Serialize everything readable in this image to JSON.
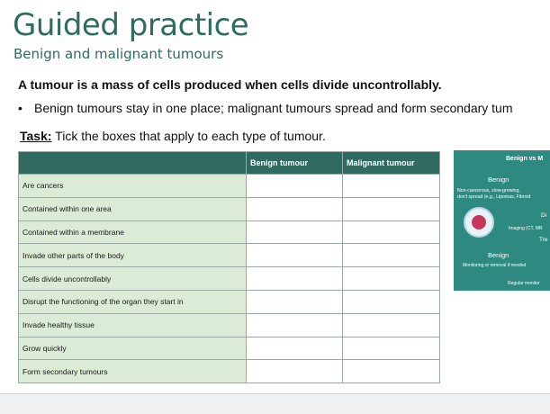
{
  "header": {
    "title": "Guided practice",
    "subtitle": "Benign and malignant tumours"
  },
  "content": {
    "statement": "A tumour is a mass of cells produced when cells divide uncontrollably.",
    "bullet": "Benign tumours stay in one place; malignant tumours spread and form secondary tum",
    "task_label": "Task:",
    "task_text": " Tick the boxes that apply to each type of tumour."
  },
  "table": {
    "columns": [
      "",
      "Benign tumour",
      "Malignant tumour"
    ],
    "rows": [
      "Are cancers",
      "Contained within one area",
      "Contained within a membrane",
      "Invade other parts of the body",
      "Cells divide uncontrollably",
      "Disrupt the functioning of the organ they start in",
      "Invade healthy tissue",
      "Grow quickly",
      "Form secondary tumours"
    ]
  },
  "infographic": {
    "heading": "Benign vs M",
    "label_benign": "Benign",
    "description_line1": "Non-cancerous, slow-growing,",
    "description_line2": "don't spread (e.g., Lipomas, Fibroid",
    "diagnosis_fragment": "Di",
    "imaging_fragment": "Imaging (CT, MR",
    "treatment_fragment": "Tre",
    "label_benign_2": "Benign",
    "monitoring_text": "Monitoring or removal if needed",
    "regular_fragment": "Regular monitor",
    "colors": {
      "panel": "#2e8a80",
      "cell": "#c6375a"
    }
  },
  "theme": {
    "accent": "#2f6b61",
    "row_label_bg": "#dcebd6"
  }
}
